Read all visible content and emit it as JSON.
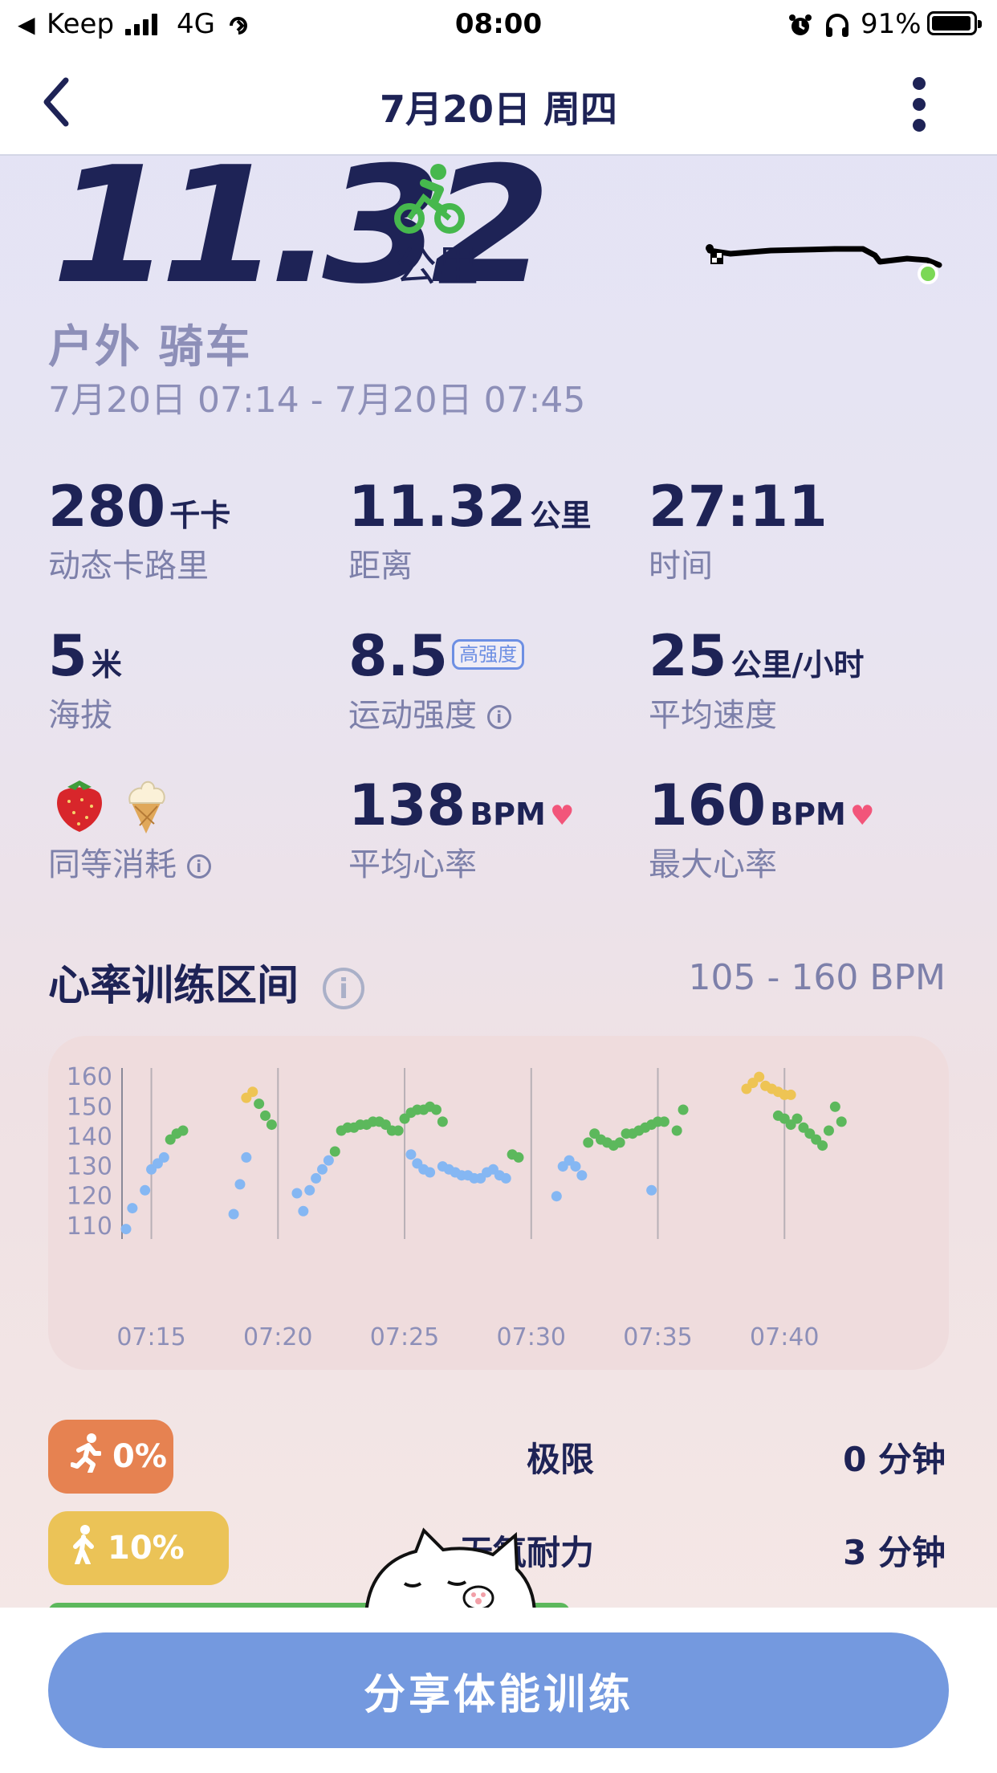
{
  "status_bar": {
    "back_app": "Keep",
    "network": "4G",
    "time": "08:00",
    "battery": "91%"
  },
  "header": {
    "title": "7月20日 周四"
  },
  "summary": {
    "distance": "11.32",
    "distance_unit": "公里",
    "activity_type": "户外 骑车",
    "time_range": "7月20日 07:14 - 7月20日 07:45"
  },
  "stats": [
    {
      "value": "280",
      "unit": "千卡",
      "label": "动态卡路里"
    },
    {
      "value": "11.32",
      "unit": "公里",
      "label": "距离"
    },
    {
      "value": "27:11",
      "unit": "",
      "label": "时间"
    },
    {
      "value": "5",
      "unit": "米",
      "label": "海拔"
    },
    {
      "value": "8.5",
      "unit": "",
      "badge": "高强度",
      "label": "运动强度"
    },
    {
      "value": "25",
      "unit": "公里/小时",
      "label": "平均速度"
    },
    {
      "value": "",
      "unit": "",
      "label": "同等消耗"
    },
    {
      "value": "138",
      "unit": "BPM",
      "label": "平均心率"
    },
    {
      "value": "160",
      "unit": "BPM",
      "label": "最大心率"
    }
  ],
  "colors": {
    "accent": "#1e2356",
    "muted": "#7d80aa",
    "zone_green": "#5cb85c",
    "zone_blue": "#85b7f3",
    "zone_yellow": "#eec454",
    "zone_orange": "#e68251",
    "share_button": "#7499df"
  },
  "heart_section": {
    "title": "心率训练区间",
    "range": "105 - 160 BPM"
  },
  "chart_data": {
    "type": "scatter",
    "title": "",
    "xlabel": "",
    "ylabel": "",
    "ylim": [
      107,
      163
    ],
    "xlim": [
      "07:14",
      "07:45"
    ],
    "y_ticks": [
      "160",
      "150",
      "140",
      "130",
      "120",
      "110"
    ],
    "x_ticks": [
      "07:15",
      "07:20",
      "07:25",
      "07:30",
      "07:35",
      "07:40"
    ],
    "series": [
      {
        "zone": "blue",
        "points": [
          [
            "07:14:00",
            109
          ],
          [
            "07:14:15",
            116
          ],
          [
            "07:14:45",
            122
          ],
          [
            "07:15:00",
            129
          ],
          [
            "07:15:15",
            131
          ],
          [
            "07:15:30",
            133
          ],
          [
            "07:18:15",
            114
          ],
          [
            "07:18:30",
            124
          ],
          [
            "07:18:45",
            133
          ],
          [
            "07:20:45",
            121
          ],
          [
            "07:21:00",
            115
          ],
          [
            "07:21:15",
            122
          ],
          [
            "07:21:30",
            126
          ],
          [
            "07:21:45",
            129
          ],
          [
            "07:22:00",
            132
          ],
          [
            "07:25:15",
            134
          ],
          [
            "07:25:30",
            131
          ],
          [
            "07:25:45",
            129
          ],
          [
            "07:26:00",
            128
          ],
          [
            "07:26:30",
            130
          ],
          [
            "07:26:45",
            129
          ],
          [
            "07:27:00",
            128
          ],
          [
            "07:27:15",
            127
          ],
          [
            "07:27:30",
            127
          ],
          [
            "07:27:45",
            126
          ],
          [
            "07:28:00",
            126
          ],
          [
            "07:28:15",
            128
          ],
          [
            "07:28:30",
            129
          ],
          [
            "07:28:45",
            127
          ],
          [
            "07:29:00",
            126
          ],
          [
            "07:31:00",
            120
          ],
          [
            "07:31:15",
            130
          ],
          [
            "07:31:30",
            132
          ],
          [
            "07:31:45",
            130
          ],
          [
            "07:32:00",
            127
          ],
          [
            "07:34:45",
            122
          ]
        ]
      },
      {
        "zone": "green",
        "points": [
          [
            "07:15:45",
            139
          ],
          [
            "07:16:00",
            141
          ],
          [
            "07:16:15",
            142
          ],
          [
            "07:19:15",
            151
          ],
          [
            "07:19:30",
            147
          ],
          [
            "07:19:45",
            144
          ],
          [
            "07:22:15",
            135
          ],
          [
            "07:22:30",
            142
          ],
          [
            "07:22:45",
            143
          ],
          [
            "07:23:00",
            143
          ],
          [
            "07:23:15",
            144
          ],
          [
            "07:23:30",
            144
          ],
          [
            "07:23:45",
            145
          ],
          [
            "07:24:00",
            145
          ],
          [
            "07:24:15",
            144
          ],
          [
            "07:24:30",
            142
          ],
          [
            "07:24:45",
            142
          ],
          [
            "07:25:00",
            146
          ],
          [
            "07:25:15",
            148
          ],
          [
            "07:25:30",
            149
          ],
          [
            "07:25:45",
            149
          ],
          [
            "07:26:00",
            150
          ],
          [
            "07:26:15",
            149
          ],
          [
            "07:26:30",
            145
          ],
          [
            "07:29:15",
            134
          ],
          [
            "07:29:30",
            133
          ],
          [
            "07:32:15",
            138
          ],
          [
            "07:32:30",
            141
          ],
          [
            "07:32:45",
            139
          ],
          [
            "07:33:00",
            138
          ],
          [
            "07:33:15",
            137
          ],
          [
            "07:33:30",
            138
          ],
          [
            "07:33:45",
            141
          ],
          [
            "07:34:00",
            141
          ],
          [
            "07:34:15",
            142
          ],
          [
            "07:34:30",
            143
          ],
          [
            "07:34:45",
            144
          ],
          [
            "07:35:00",
            145
          ],
          [
            "07:35:15",
            145
          ],
          [
            "07:35:45",
            142
          ],
          [
            "07:36:00",
            149
          ],
          [
            "07:39:45",
            147
          ],
          [
            "07:40:00",
            146
          ],
          [
            "07:40:15",
            144
          ],
          [
            "07:40:30",
            146
          ],
          [
            "07:40:45",
            143
          ],
          [
            "07:41:00",
            141
          ],
          [
            "07:41:15",
            139
          ],
          [
            "07:41:30",
            137
          ],
          [
            "07:41:45",
            142
          ],
          [
            "07:42:00",
            150
          ],
          [
            "07:42:15",
            145
          ]
        ]
      },
      {
        "zone": "yellow",
        "points": [
          [
            "07:18:45",
            153
          ],
          [
            "07:19:00",
            155
          ],
          [
            "07:38:30",
            156
          ],
          [
            "07:38:45",
            158
          ],
          [
            "07:39:00",
            160
          ],
          [
            "07:39:15",
            157
          ],
          [
            "07:39:30",
            156
          ],
          [
            "07:39:45",
            155
          ],
          [
            "07:40:00",
            154
          ],
          [
            "07:40:15",
            154
          ]
        ]
      }
    ]
  },
  "zones": [
    {
      "percent": "0%",
      "color": "orange",
      "name": "极限",
      "minutes": "0 分钟"
    },
    {
      "percent": "10%",
      "color": "yellow",
      "name": "无氧耐力",
      "minutes": "3 分钟"
    }
  ],
  "share_button": {
    "label": "分享体能训练"
  }
}
